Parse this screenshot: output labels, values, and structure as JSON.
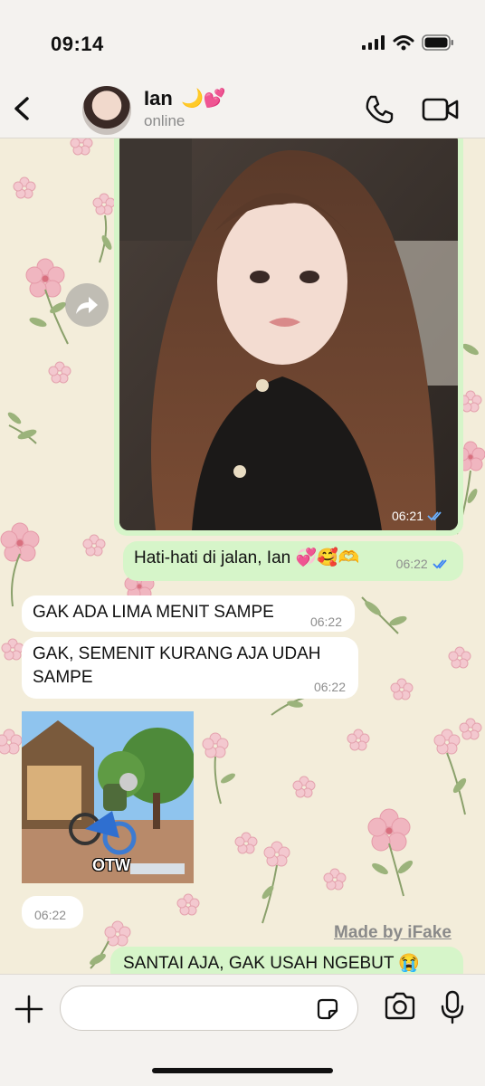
{
  "status_bar": {
    "time": "09:14"
  },
  "header": {
    "contact_name": "Ian",
    "contact_emoji": "🌙💕",
    "contact_status": "online"
  },
  "messages": [
    {
      "type": "image",
      "direction": "outgoing",
      "time": "06:21",
      "read": true
    },
    {
      "type": "text",
      "direction": "outgoing",
      "text": "Hati-hati di jalan, Ian 💞🥰🫶",
      "time": "06:22",
      "read": true
    },
    {
      "type": "text",
      "direction": "incoming",
      "text": "GAK ADA LIMA MENIT SAMPE",
      "time": "06:22"
    },
    {
      "type": "text",
      "direction": "incoming",
      "text": "GAK, SEMENIT KURANG AJA UDAH SAMPE",
      "time": "06:22"
    },
    {
      "type": "sticker",
      "direction": "incoming",
      "caption": "OTW"
    },
    {
      "type": "time-only",
      "direction": "incoming",
      "time": "06:22"
    },
    {
      "type": "text",
      "direction": "outgoing",
      "text": "SANTAI AJA, GAK USAH NGEBUT 😭"
    }
  ],
  "watermark": "Made by iFake",
  "input": {
    "placeholder": ""
  },
  "colors": {
    "outgoing_bubble": "#d6f5c9",
    "incoming_bubble": "#ffffff",
    "read_ticks": "#3b82f6",
    "wallpaper": "#f3edda"
  },
  "icons": [
    "back-chevron-icon",
    "phone-icon",
    "video-camera-icon",
    "forward-icon",
    "plus-icon",
    "sticker-icon",
    "camera-icon",
    "microphone-icon"
  ]
}
